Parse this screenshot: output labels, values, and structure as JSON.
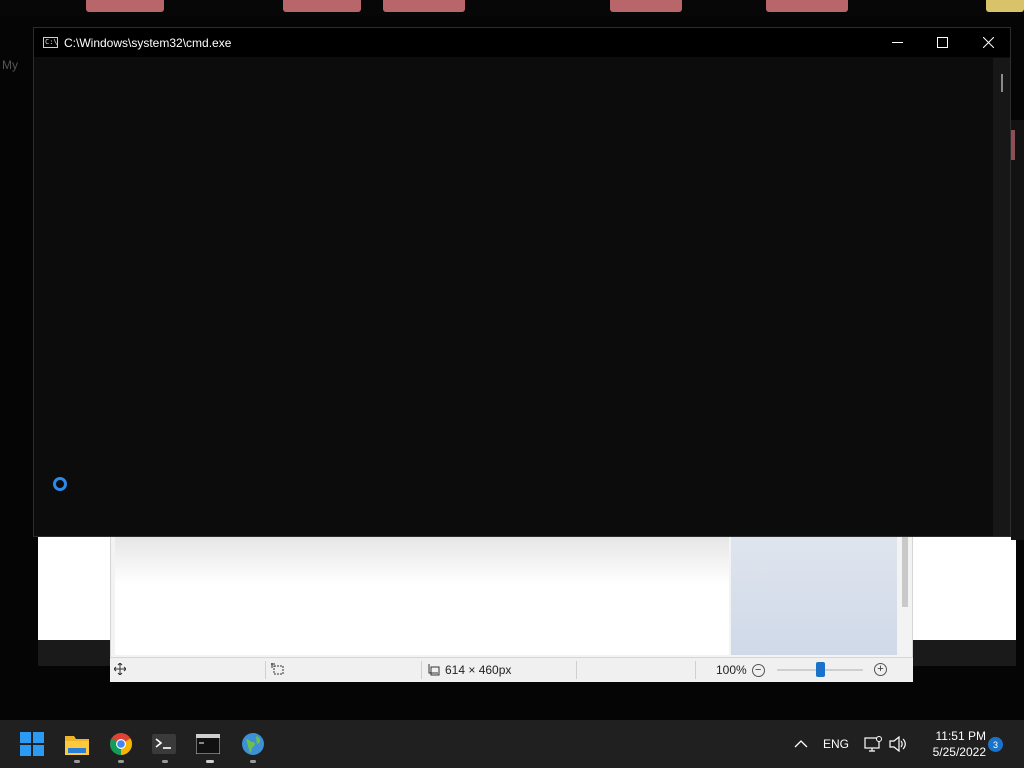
{
  "cmd_window": {
    "title": "C:\\Windows\\system32\\cmd.exe",
    "icon": "cmd-icon",
    "minimize_icon": "minimize-icon",
    "maximize_icon": "maximize-icon",
    "close_icon": "close-icon"
  },
  "background_text": {
    "left_fragment": "My"
  },
  "paint_status": {
    "image_size": "614 × 460px",
    "zoom": "100%",
    "zoom_level_fraction": 0.5
  },
  "taskbar": {
    "apps": [
      "start-icon",
      "file-explorer-icon",
      "chrome-icon",
      "terminal-icon",
      "cmd-icon",
      "network-globe-icon"
    ],
    "language": "ENG",
    "time": "11:51 PM",
    "date": "5/25/2022",
    "notification_count": "3",
    "accent_color": "#1a73c9"
  }
}
